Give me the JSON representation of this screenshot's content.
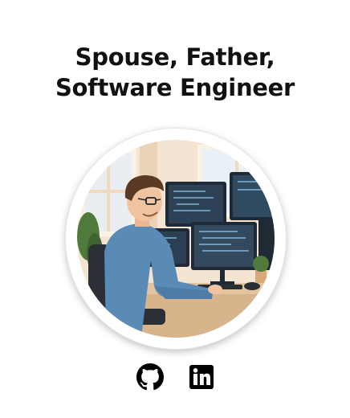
{
  "header": {
    "line1": "Spouse, Father,",
    "line2": "Software Engineer"
  },
  "avatar": {
    "icon": "developer-illustration"
  },
  "socials": [
    {
      "icon": "github-icon"
    },
    {
      "icon": "linkedin-icon"
    }
  ],
  "colors": {
    "text": "#111111",
    "background": "#ffffff",
    "shirt": "#5a8ab6",
    "wall": "#f3e2cf",
    "screen": "#2b3b4d"
  }
}
